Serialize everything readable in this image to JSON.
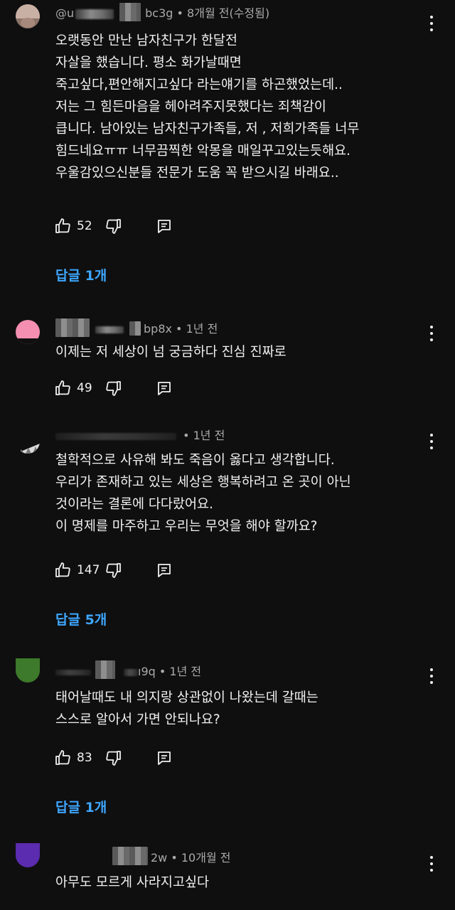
{
  "comments": [
    {
      "author_visible": "@u",
      "author_suffix": "bc3g",
      "time": " • 8개월 전(수정됨)",
      "text": "오랫동안 만난 남자친구가 한달전\n자살을 했습니다. 평소 화가날때면\n죽고싶다,편안해지고싶다 라는얘기를 하곤했었는데..\n저는 그 힘든마음을 헤아려주지못했다는 죄책감이\n큽니다. 남아있는 남자친구가족들, 저 , 저희가족들 너무\n힘드네요ㅠㅠ 너무끔찍한 악몽을 매일꾸고있는듯해요.\n우울감있으신분들 전문가 도움 꼭 받으시길 바래요..",
      "likes": "52",
      "replies": "답글 1개",
      "avatar_color": "#b59b90"
    },
    {
      "author_suffix": "bp8x",
      "time": " • 1년 전",
      "text": "이제는 저 세상이 넘 궁금하다 진심 진짜로",
      "likes": "49",
      "avatar_color": "#f48fb1"
    },
    {
      "author_suffix": "",
      "time": " • 1년 전",
      "text": "철학적으로 사유해 봐도 죽음이 옳다고 생각합니다.\n우리가 존재하고 있는 세상은 행복하려고 온 곳이 아닌\n것이라는 결론에 다다랐어요.\n이 명제를 마주하고 우리는 무엇을 해야 할까요?",
      "likes": "147",
      "replies": "답글 5개",
      "avatar_color": "#c8c8c8"
    },
    {
      "author_suffix": "ı9q",
      "time": " • 1년 전",
      "text": "태어날때도 내 의지랑 상관없이 나왔는데 갈때는\n스스로 알아서 가면 안되나요?",
      "likes": "83",
      "replies": "답글 1개",
      "avatar_color": "#3d7a2b"
    },
    {
      "author_suffix": "2w",
      "time": " • 10개월 전",
      "text": "아무도 모르게 사라지고싶다",
      "avatar_color": "#5b2bb0"
    }
  ],
  "icons": {
    "like": "thumbs-up-icon",
    "dislike": "thumbs-down-icon",
    "reply": "reply-icon",
    "more": "more-vertical-icon"
  },
  "colors": {
    "background": "#0f0f0f",
    "text": "#f1f1f1",
    "secondary": "#aaaaaa",
    "link": "#3ea6ff"
  }
}
